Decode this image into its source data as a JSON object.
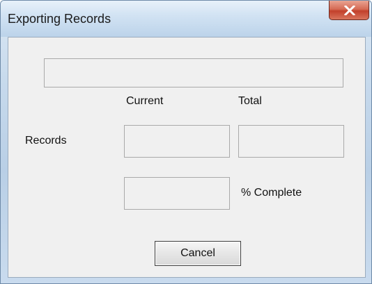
{
  "window": {
    "title": "Exporting Records",
    "close_icon": "close-icon"
  },
  "status_field": {
    "value": ""
  },
  "columns": {
    "current_label": "Current",
    "total_label": "Total"
  },
  "records": {
    "label": "Records",
    "current_value": "",
    "total_value": ""
  },
  "percent": {
    "value": "",
    "label": "% Complete"
  },
  "buttons": {
    "cancel_label": "Cancel"
  },
  "colors": {
    "client_background": "#f0f0f0",
    "close_button": "#c2402b"
  }
}
